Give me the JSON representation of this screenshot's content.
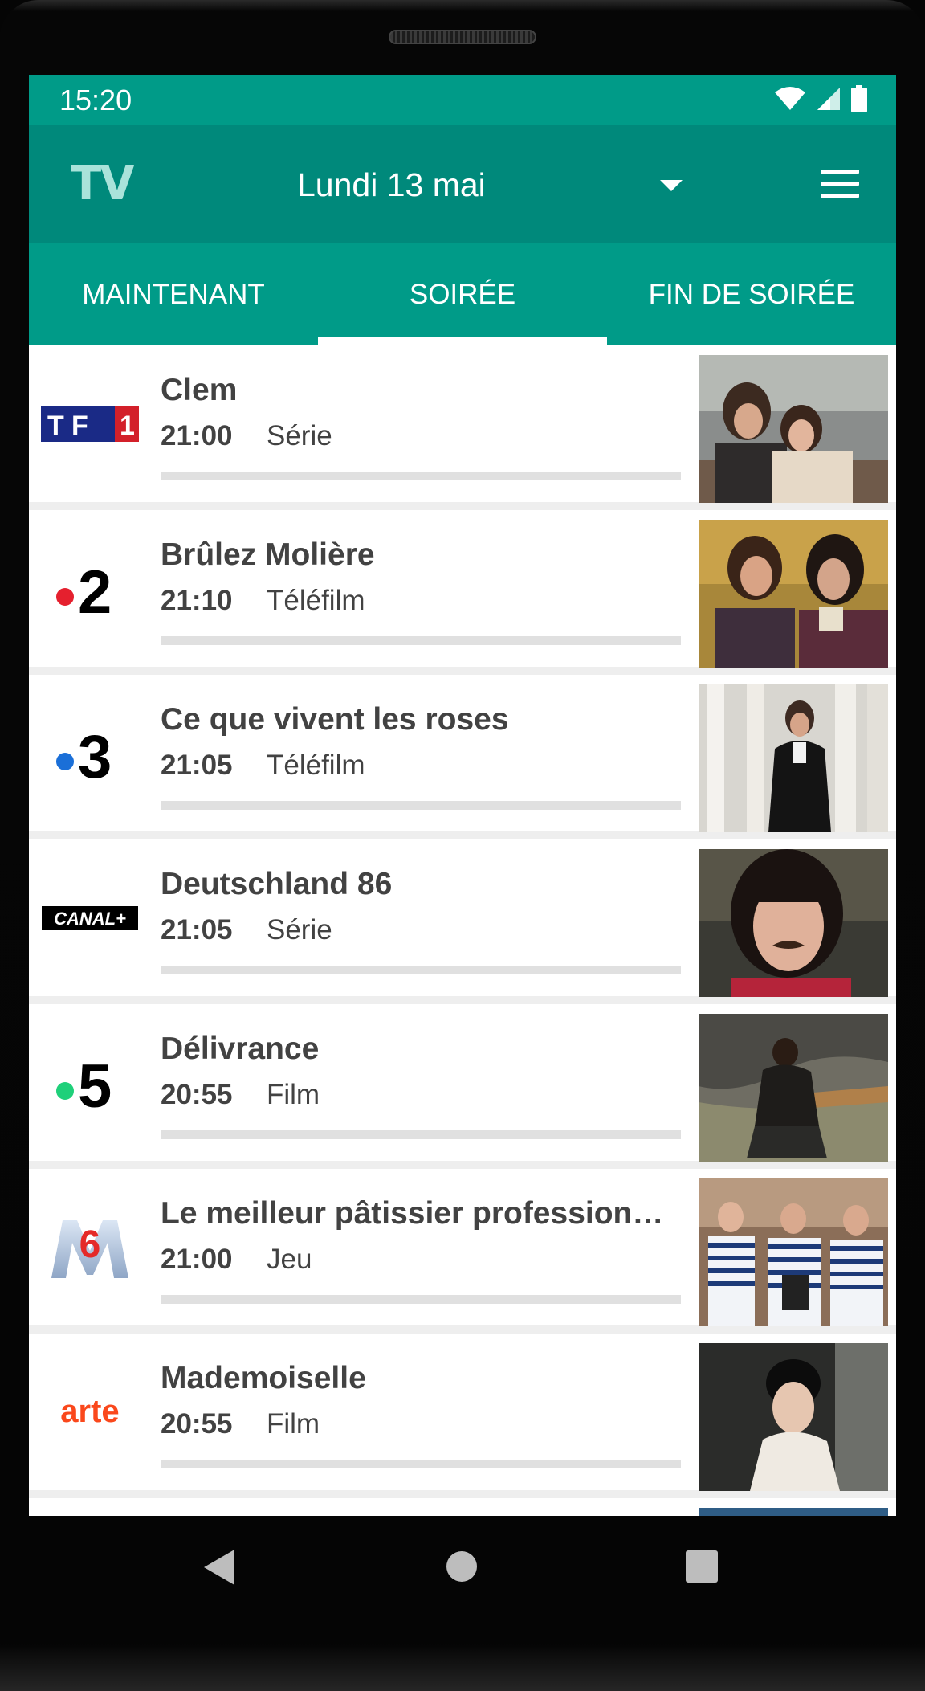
{
  "status": {
    "time": "15:20"
  },
  "appbar": {
    "logo": "TV",
    "date": "Lundi 13 mai"
  },
  "tabs": [
    {
      "label": "MAINTENANT",
      "active": false
    },
    {
      "label": "SOIRÉE",
      "active": true
    },
    {
      "label": "FIN DE SOIRÉE",
      "active": false
    }
  ],
  "programs": [
    {
      "channel": "TF1",
      "title": "Clem",
      "time": "21:00",
      "genre": "Série",
      "progress": 0
    },
    {
      "channel": "France 2",
      "title": "Brûlez Molière",
      "time": "21:10",
      "genre": "Téléfilm",
      "progress": 0
    },
    {
      "channel": "France 3",
      "title": "Ce que vivent les roses",
      "time": "21:05",
      "genre": "Téléfilm",
      "progress": 0
    },
    {
      "channel": "CANAL+",
      "title": "Deutschland 86",
      "time": "21:05",
      "genre": "Série",
      "progress": 0
    },
    {
      "channel": "France 5",
      "title": "Délivrance",
      "time": "20:55",
      "genre": "Film",
      "progress": 0
    },
    {
      "channel": "M6",
      "title": "Le meilleur pâtissier professionnels",
      "time": "21:00",
      "genre": "Jeu",
      "progress": 0
    },
    {
      "channel": "arte",
      "title": "Mademoiselle",
      "time": "20:55",
      "genre": "Film",
      "progress": 0
    }
  ],
  "logos": {
    "tf1": "TF1",
    "f2": "2",
    "f3": "3",
    "canal": "CANAL+",
    "f5": "5",
    "m6": "6",
    "arte": "arte"
  },
  "colors": {
    "statusbar": "#009b88",
    "appbar": "#00897b",
    "tabs": "#009b88"
  },
  "icons": [
    "wifi-icon",
    "signal-icon",
    "battery-icon",
    "dropdown-arrow-icon",
    "menu-icon",
    "back-icon",
    "home-icon",
    "recents-icon"
  ]
}
